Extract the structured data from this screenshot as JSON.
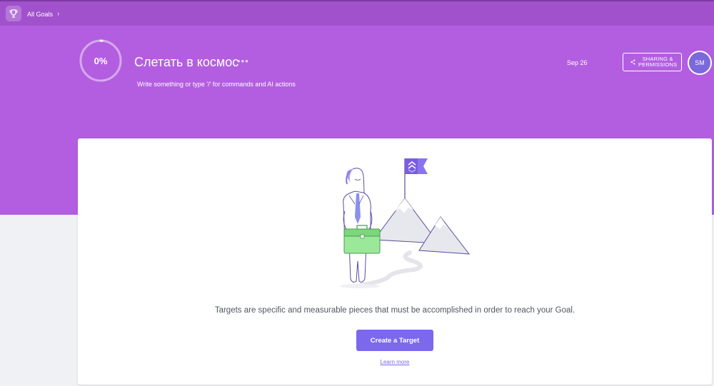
{
  "header": {
    "breadcrumb_label": "All Goals",
    "breadcrumb_chevron": "›",
    "trophy_icon": "trophy-icon"
  },
  "goal": {
    "progress_percent": 0,
    "progress_label": "0%",
    "title": "Слетать в космос",
    "more_label": "•••",
    "description_placeholder": "Write something or type '/' for commands and AI actions",
    "due_date": "Sep 26",
    "share_line1": "SHARING &",
    "share_line2": "PERMISSIONS",
    "avatar_initials": "SM"
  },
  "empty_state": {
    "message": "Targets are specific and measurable pieces that must be accomplished in order to reach your Goal.",
    "create_button": "Create a Target",
    "learn_more": "Learn more"
  },
  "colors": {
    "topbar": "#a151cc",
    "hero": "#b35ee0",
    "accent": "#7b68ee",
    "avatar": "#7a68dc"
  }
}
